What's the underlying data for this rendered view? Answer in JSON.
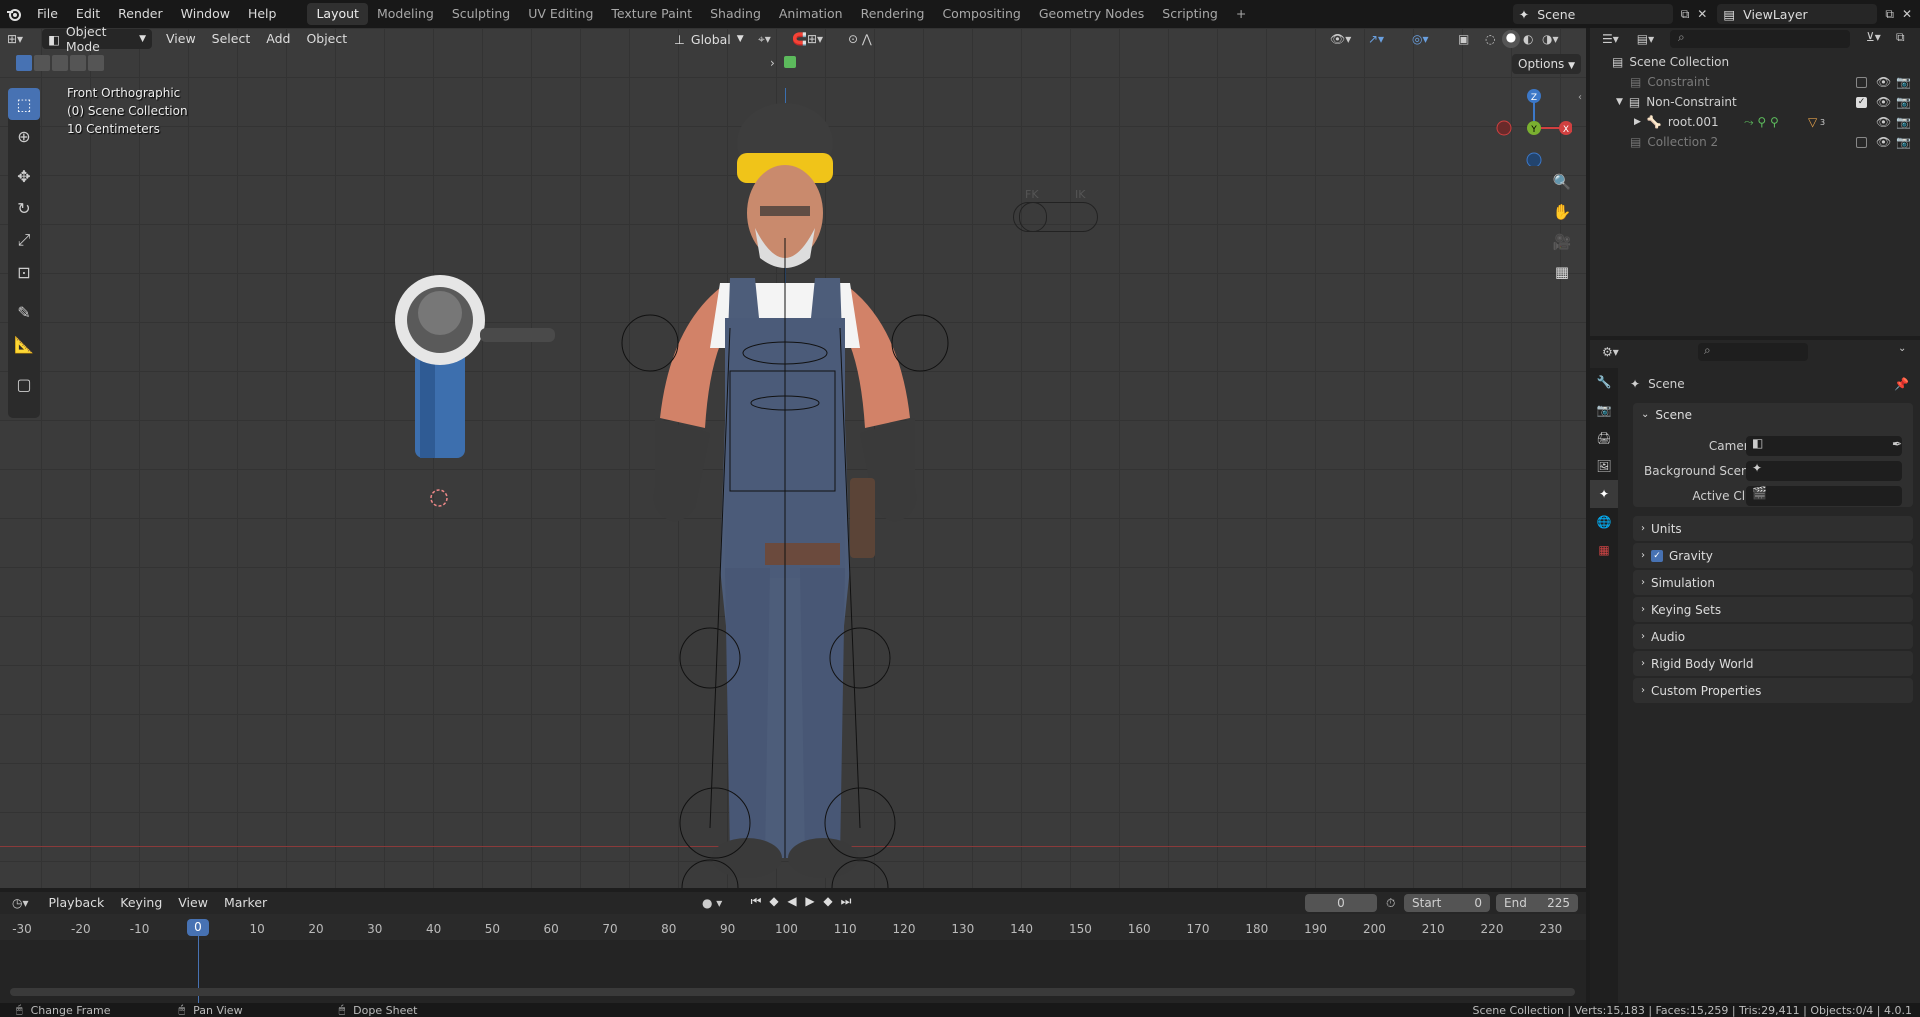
{
  "app": {
    "logo": "blender-logo-icon"
  },
  "menus": [
    "File",
    "Edit",
    "Render",
    "Window",
    "Help"
  ],
  "workspaces": [
    "Layout",
    "Modeling",
    "Sculpting",
    "UV Editing",
    "Texture Paint",
    "Shading",
    "Animation",
    "Rendering",
    "Compositing",
    "Geometry Nodes",
    "Scripting"
  ],
  "active_workspace": "Layout",
  "scene_name": "Scene",
  "view_layer": "ViewLayer",
  "viewport": {
    "mode": "Object Mode",
    "menus": [
      "View",
      "Select",
      "Add",
      "Object"
    ],
    "orientation": "Global",
    "options": "Options",
    "view_name": "Front Orthographic",
    "collection": "(0) Scene Collection",
    "scale": "10 Centimeters",
    "fk_label": "FK",
    "ik_label": "IK",
    "gizmo": {
      "z": "Z",
      "y": "Y",
      "x": "X"
    }
  },
  "outliner": {
    "root": "Scene Collection",
    "items": [
      {
        "label": "Constraint",
        "checked": false
      },
      {
        "label": "Non-Constraint",
        "checked": true
      },
      {
        "label": "root.001",
        "badge": "3"
      },
      {
        "label": "Collection 2",
        "checked": false
      }
    ]
  },
  "properties": {
    "header": "Scene",
    "section": "Scene",
    "fields": {
      "camera": "Camera",
      "background_scene": "Background Scene",
      "active_clip": "Active Clip"
    },
    "panels": [
      "Units",
      "Gravity",
      "Simulation",
      "Keying Sets",
      "Audio",
      "Rigid Body World",
      "Custom Properties"
    ]
  },
  "timeline": {
    "menus": [
      "Playback",
      "Keying",
      "View",
      "Marker"
    ],
    "current_frame": "0",
    "start_label": "Start",
    "start": "0",
    "end_label": "End",
    "end": "225",
    "ticks": [
      "-30",
      "-20",
      "-10",
      "0",
      "10",
      "20",
      "30",
      "40",
      "50",
      "60",
      "70",
      "80",
      "90",
      "100",
      "110",
      "120",
      "130",
      "140",
      "150",
      "160",
      "170",
      "180",
      "190",
      "200",
      "210",
      "220",
      "230"
    ]
  },
  "status": {
    "left": [
      {
        "icon": "mouse-left-icon",
        "label": "Change Frame"
      },
      {
        "icon": "mouse-middle-icon",
        "label": "Pan View"
      },
      {
        "icon": "mouse-right-icon",
        "label": "Dope Sheet"
      }
    ],
    "right": "Scene Collection | Verts:15,183 | Faces:15,259 | Tris:29,411 | Objects:0/4 | 4.0.1"
  }
}
